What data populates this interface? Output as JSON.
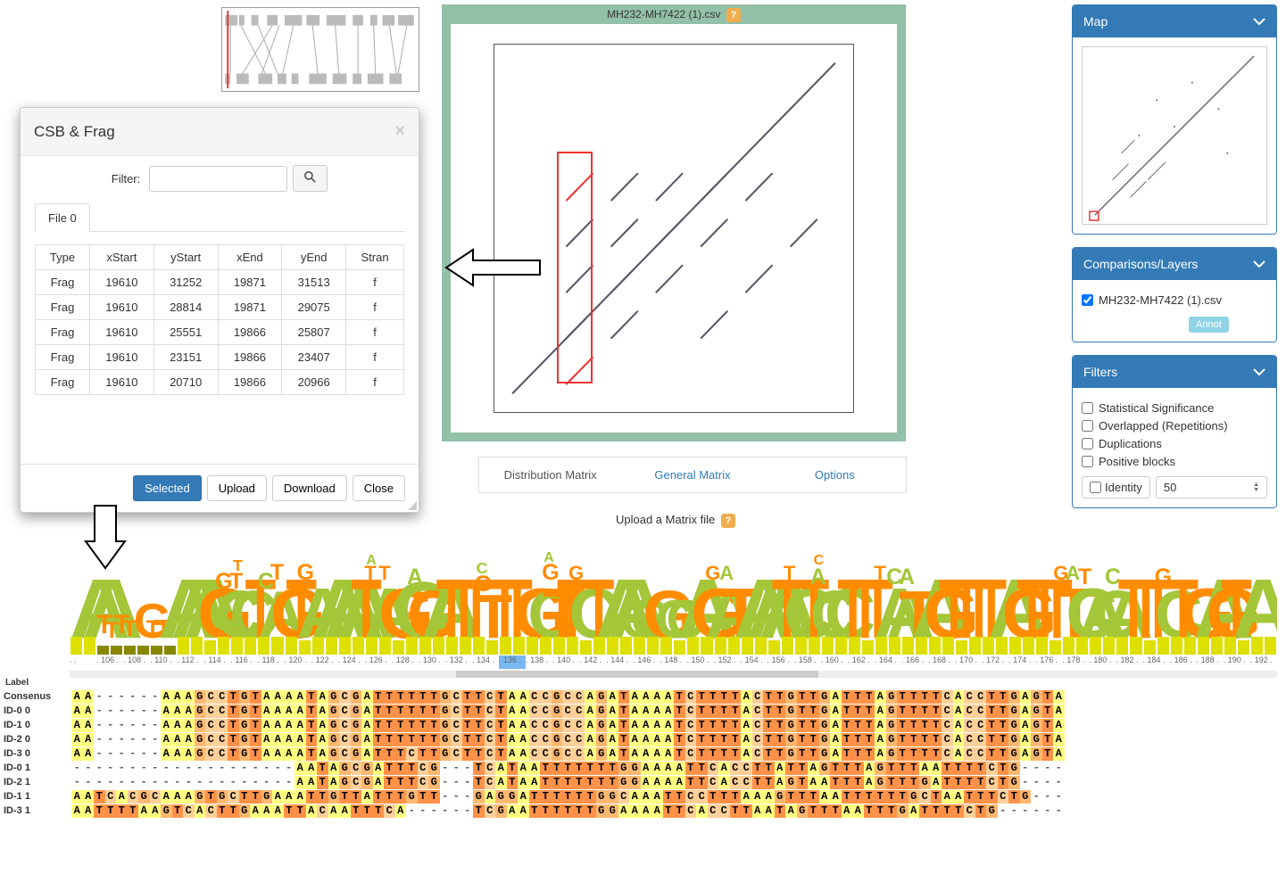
{
  "dialog": {
    "title": "CSB & Frag",
    "filter_label": "Filter:",
    "tab_label": "File 0",
    "columns": [
      "Type",
      "xStart",
      "yStart",
      "xEnd",
      "yEnd",
      "Stran"
    ],
    "rows": [
      [
        "Frag",
        "19610",
        "31252",
        "19871",
        "31513",
        "f"
      ],
      [
        "Frag",
        "19610",
        "28814",
        "19871",
        "29075",
        "f"
      ],
      [
        "Frag",
        "19610",
        "25551",
        "19866",
        "25807",
        "f"
      ],
      [
        "Frag",
        "19610",
        "23151",
        "19866",
        "23407",
        "f"
      ],
      [
        "Frag",
        "19610",
        "20710",
        "19866",
        "20966",
        "f"
      ]
    ],
    "buttons": {
      "selected": "Selected",
      "upload": "Upload",
      "download": "Download",
      "close": "Close"
    }
  },
  "main_plot": {
    "title": "MH232-MH7422 (1).csv"
  },
  "plot_tabs": {
    "distribution": "Distribution Matrix",
    "general": "General Matrix",
    "options": "Options"
  },
  "upload_text": "Upload a Matrix file",
  "panels": {
    "map_title": "Map",
    "comp_title": "Comparisons/Layers",
    "comp_item": "MH232-MH7422 (1).csv",
    "comp_annot": "Annot",
    "filters_title": "Filters",
    "filter_items": [
      "Statistical Significance",
      "Overlapped (Repetitions)",
      "Duplications",
      "Positive blocks"
    ],
    "identity_label": "Identity",
    "identity_value": "50"
  },
  "alignment": {
    "label_title": "Label",
    "ruler": [
      "",
      "106",
      "108",
      "110",
      "112",
      "114",
      "116",
      "118",
      "120",
      "122",
      "124",
      "126",
      "128",
      "130",
      "132",
      "134",
      "136",
      "138",
      "140",
      "142",
      "144",
      "146",
      "148",
      "150",
      "152",
      "154",
      "156",
      "158",
      "160",
      "162",
      "164",
      "166",
      "168",
      "170",
      "172",
      "174",
      "176",
      "178",
      "180",
      "182",
      "184",
      "186",
      "188",
      "190",
      "192"
    ],
    "rows": [
      {
        "label": "Consenus",
        "seq": "AA------AAAGCCTGTAAAATAGCGATTTTTTGCTTCTAACCGCCAGATAAAATCTTTTACTTGTTGATTTAGTTTTCACCTTGAGTA"
      },
      {
        "label": "ID-0 0",
        "seq": "AA------AAAGCCTGTAAAATAGCGATTTTTTGCTTCTAACCGCCAGATAAAATCTTTTACTTGTTGATTTAGTTTTCACCTTGAGTA"
      },
      {
        "label": "ID-1 0",
        "seq": "AA------AAAGCCTGTAAAATAGCGATTTTTTGCTTCTAACCGCCAGATAAAATCTTTTACTTGTTGATTTAGTTTTCACCTTGAGTA"
      },
      {
        "label": "ID-2 0",
        "seq": "AA------AAAGCCTGTAAAATAGCGATTTTTTGCTTCTAACCGCCAGATAAAATCTTTTACTTGTTGATTTAGTTTTCACCTTGAGTA"
      },
      {
        "label": "ID-3 0",
        "seq": "AA------AAAGCCTGTAAAATAGCGATTTCTTGCTTCTAACCGCCAGATAAAATCTTTTACTTGTTGATTTAGTTTTCACCTTGAGTA"
      },
      {
        "label": "ID-0 1",
        "seq": "--------------------AATAGCGATTTCG---TCATAATTTTTTTGGAAAATTCACCTTATTAGTTTAGTTTAATTTTCTG----"
      },
      {
        "label": "ID-2 1",
        "seq": "--------------------AATAGCGATTTCG---TCATAATTTTTTTGGAAAATTCACCTTAGTAATTTAGTTTGATTTTCTG----"
      },
      {
        "label": "ID-1 1",
        "seq": "AATCACGCAAAGTGCTTGAAATTGTTATTTGTT---GAGGATTTTTTGGCAAATTCCTTTAAAGTTTAATTTTTTGCTAATTTCTG---"
      },
      {
        "label": "ID-3 1",
        "seq": "AATTTTAAGTCACTTGAAATTACAATTTCA------TCGAATTTTTTGGAAAATTCACCTTAATAGTTTAATTTGATTTTCTG------"
      }
    ]
  }
}
